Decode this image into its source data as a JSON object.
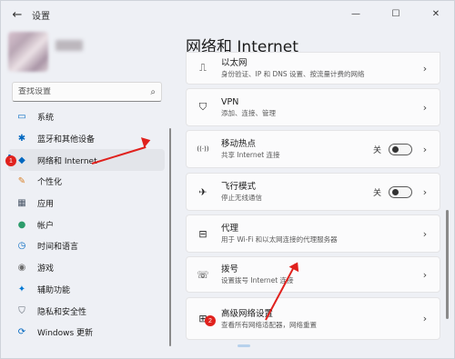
{
  "window": {
    "title": "设置",
    "back_icon": "←",
    "controls": {
      "minimize": "—",
      "maximize": "☐",
      "close": "✕"
    }
  },
  "sidebar": {
    "search_placeholder": "查找设置",
    "items": [
      {
        "label": "系统",
        "icon": "monitor-icon",
        "glyph": "▭",
        "color": "#0067c0"
      },
      {
        "label": "蓝牙和其他设备",
        "icon": "bluetooth-icon",
        "glyph": "✱",
        "color": "#0067c0"
      },
      {
        "label": "网络和 Internet",
        "icon": "wifi-icon",
        "glyph": "◆",
        "color": "#0067c0",
        "selected": true
      },
      {
        "label": "个性化",
        "icon": "brush-icon",
        "glyph": "✎",
        "color": "#d9822b"
      },
      {
        "label": "应用",
        "icon": "apps-icon",
        "glyph": "▦",
        "color": "#4a5668"
      },
      {
        "label": "帐户",
        "icon": "account-icon",
        "glyph": "●",
        "color": "#2c9c6b"
      },
      {
        "label": "时间和语言",
        "icon": "globe-clock-icon",
        "glyph": "◷",
        "color": "#0067c0"
      },
      {
        "label": "游戏",
        "icon": "gamepad-icon",
        "glyph": "◉",
        "color": "#6b6b6b"
      },
      {
        "label": "辅助功能",
        "icon": "accessibility-icon",
        "glyph": "✦",
        "color": "#0078d4"
      },
      {
        "label": "隐私和安全性",
        "icon": "shield-icon",
        "glyph": "⛉",
        "color": "#5c6570"
      },
      {
        "label": "Windows 更新",
        "icon": "update-icon",
        "glyph": "⟳",
        "color": "#0067c0"
      }
    ]
  },
  "main": {
    "title": "网络和 Internet",
    "cards": [
      {
        "title": "以太网",
        "desc": "身份验证、IP 和 DNS 设置、按流量计费的网络",
        "icon": "ethernet-icon",
        "glyph": "⎍"
      },
      {
        "title": "VPN",
        "desc": "添加、连接、管理",
        "icon": "vpn-shield-icon",
        "glyph": "⛉"
      },
      {
        "title": "移动热点",
        "desc": "共享 Internet 连接",
        "icon": "hotspot-icon",
        "glyph": "((·))",
        "toggle_label": "关"
      },
      {
        "title": "飞行模式",
        "desc": "停止无线通信",
        "icon": "airplane-icon",
        "glyph": "✈",
        "toggle_label": "关"
      },
      {
        "title": "代理",
        "desc": "用于 Wi-Fi 和以太网连接的代理服务器",
        "icon": "proxy-icon",
        "glyph": "⊟"
      },
      {
        "title": "拨号",
        "desc": "设置拨号 Internet 连接",
        "icon": "dialup-icon",
        "glyph": "☏"
      },
      {
        "title": "高级网络设置",
        "desc": "查看所有网络适配器，网络重置",
        "icon": "network-adapter-icon",
        "glyph": "⊞"
      }
    ]
  },
  "annotations": {
    "step1": "1",
    "step2": "2",
    "accent": "#e0211d"
  }
}
